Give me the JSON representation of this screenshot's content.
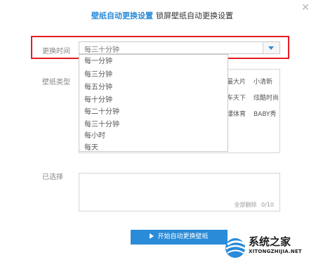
{
  "tabs": {
    "active": "壁纸自动更换设置",
    "inactive": "锁屏壁纸自动更换设置"
  },
  "close_icon": "close-icon",
  "change_time": {
    "label": "更换时间",
    "value": "每三十分钟",
    "options": [
      "每一分钟",
      "每三分钟",
      "每五分钟",
      "每十分钟",
      "每二十分钟",
      "每三十分钟",
      "每小时",
      "每天"
    ]
  },
  "wallpaper_type": {
    "label": "壁纸类型",
    "visible_categories": [
      "最大片",
      "小清新",
      "车天下",
      "炫酷时尚",
      "爆体育",
      "BABY秀"
    ]
  },
  "selected": {
    "label": "已选择",
    "clear_all": "全部删除",
    "count": "0/10"
  },
  "start_button": {
    "label": "开始自动更换壁纸"
  },
  "watermark": {
    "text": "系统之家",
    "url": "XITONGZHIJIA.NET"
  },
  "colors": {
    "accent": "#2a8bd8",
    "highlight": "#e51c23"
  }
}
